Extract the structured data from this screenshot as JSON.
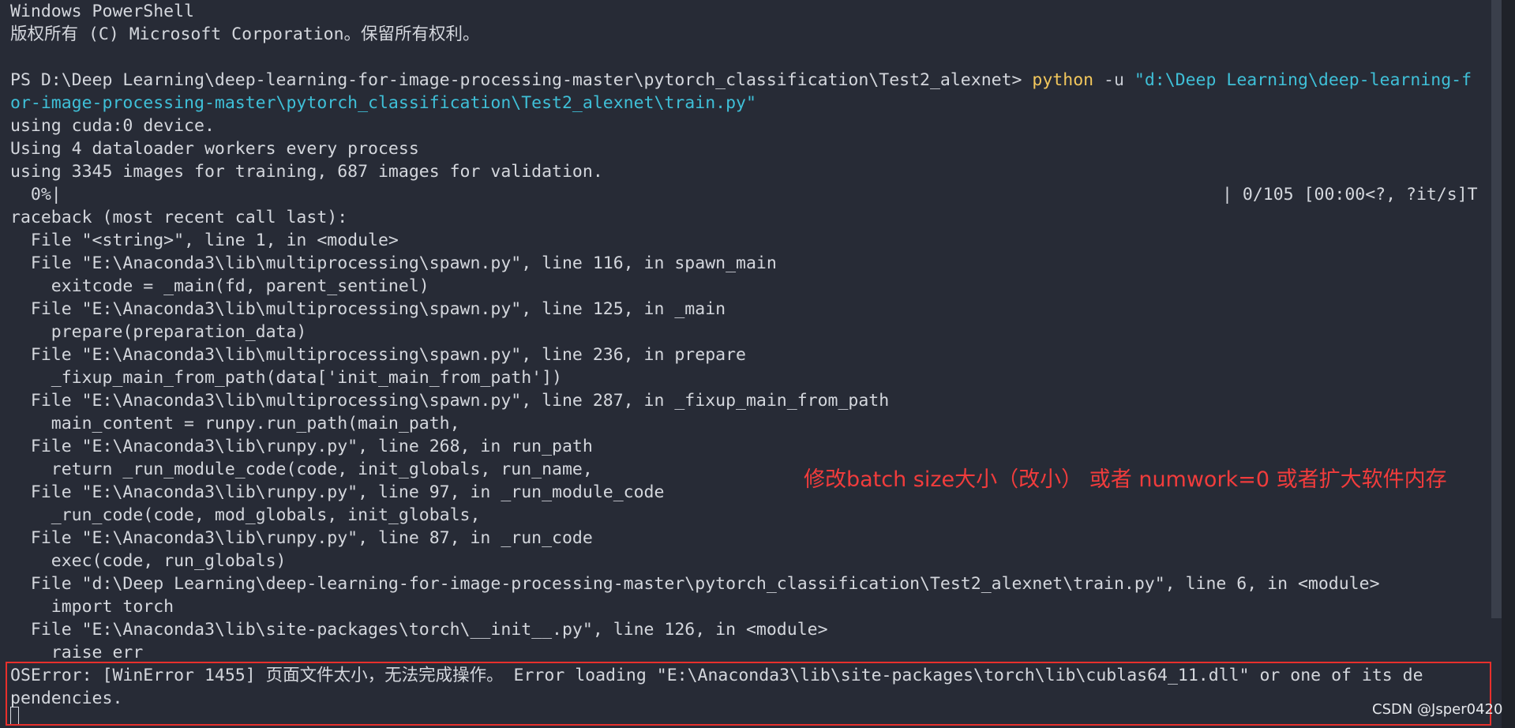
{
  "terminal": {
    "line_01": "Windows PowerShell",
    "line_02": "版权所有 (C) Microsoft Corporation。保留所有权利。",
    "prompt": "PS D:\\Deep Learning\\deep-learning-for-image-processing-master\\pytorch_classification\\Test2_alexnet> ",
    "cmd_python": "python",
    "cmd_flag": " -u ",
    "cmd_path_part1": "\"d:\\Deep Learning\\deep-learning-f",
    "cmd_path_part2": "or-image-processing-master\\pytorch_classification\\Test2_alexnet\\train.py\"",
    "line_05": "using cuda:0 device.",
    "line_06": "Using 4 dataloader workers every process",
    "line_07": "using 3345 images for training, 687 images for validation.",
    "progress_left": "  0%|",
    "progress_right": "| 0/105 [00:00<?, ?it/s]T",
    "line_09": "raceback (most recent call last):",
    "line_10": "  File \"<string>\", line 1, in <module>",
    "line_11": "  File \"E:\\Anaconda3\\lib\\multiprocessing\\spawn.py\", line 116, in spawn_main",
    "line_12": "    exitcode = _main(fd, parent_sentinel)",
    "line_13": "  File \"E:\\Anaconda3\\lib\\multiprocessing\\spawn.py\", line 125, in _main",
    "line_14": "    prepare(preparation_data)",
    "line_15": "  File \"E:\\Anaconda3\\lib\\multiprocessing\\spawn.py\", line 236, in prepare",
    "line_16": "    _fixup_main_from_path(data['init_main_from_path'])",
    "line_17": "  File \"E:\\Anaconda3\\lib\\multiprocessing\\spawn.py\", line 287, in _fixup_main_from_path",
    "line_18": "    main_content = runpy.run_path(main_path,",
    "line_19": "  File \"E:\\Anaconda3\\lib\\runpy.py\", line 268, in run_path",
    "line_20": "    return _run_module_code(code, init_globals, run_name,",
    "line_21": "  File \"E:\\Anaconda3\\lib\\runpy.py\", line 97, in _run_module_code",
    "line_22": "    _run_code(code, mod_globals, init_globals,",
    "line_23": "  File \"E:\\Anaconda3\\lib\\runpy.py\", line 87, in _run_code",
    "line_24": "    exec(code, run_globals)",
    "line_25": "  File \"d:\\Deep Learning\\deep-learning-for-image-processing-master\\pytorch_classification\\Test2_alexnet\\train.py\", line 6, in <module>",
    "line_26": "    import torch",
    "line_27": "  File \"E:\\Anaconda3\\lib\\site-packages\\torch\\__init__.py\", line 126, in <module>",
    "line_28": "    raise err",
    "error_line_1": "OSError: [WinError 1455] 页面文件太小，无法完成操作。 Error loading \"E:\\Anaconda3\\lib\\site-packages\\torch\\lib\\cublas64_11.dll\" or one of its de",
    "error_line_2": "pendencies."
  },
  "annotation": {
    "text": "修改batch size大小（改小） 或者 numwork=0 或者扩大软件内存"
  },
  "watermark": {
    "text": "CSDN @Jsper0420"
  },
  "colors": {
    "background": "#272b36",
    "text": "#d4d7dd",
    "command": "#f2c75c",
    "string": "#3fc0d8",
    "annotation": "#f13c3c",
    "highlight_box": "#e8302c"
  }
}
